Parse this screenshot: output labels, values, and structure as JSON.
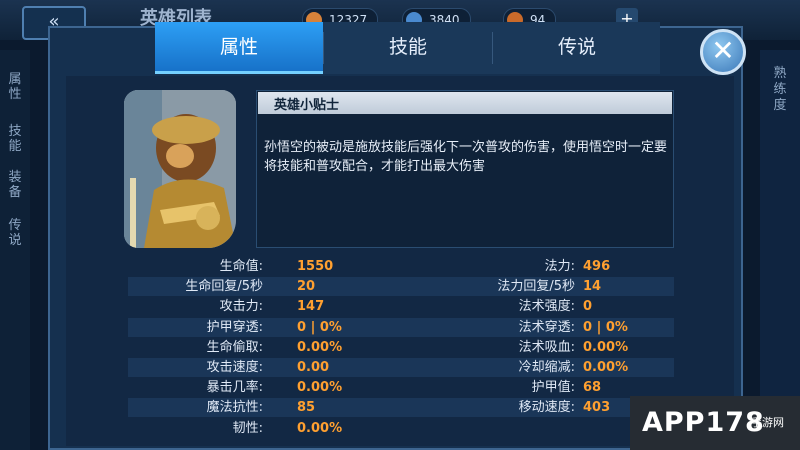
{
  "background": {
    "back_glyph": "«",
    "title": "英雄列表",
    "resources": [
      {
        "value": "12327",
        "color": "#d7823a"
      },
      {
        "value": "3840",
        "color": "#4a8ad0"
      },
      {
        "value": "94",
        "color": "#c96a2a"
      }
    ],
    "plus": "+",
    "left_tabs": [
      "属性",
      "技能",
      "装备",
      "传说"
    ],
    "right_tab": "熟练度"
  },
  "modal": {
    "tabs": [
      "属性",
      "技能",
      "传说"
    ],
    "active_tab": 0,
    "close_glyph": "✕",
    "tip": {
      "title": "英雄小贴士",
      "text": "孙悟空的被动是施放技能后强化下一次普攻的伤害，使用悟空时一定要将技能和普攻配合，才能打出最大伤害"
    },
    "stats": [
      {
        "l_label": "生命值:",
        "l_value": "1550",
        "r_label": "法力:",
        "r_value": "496"
      },
      {
        "l_label": "生命回复/5秒",
        "l_value": "20",
        "r_label": "法力回复/5秒",
        "r_value": "14"
      },
      {
        "l_label": "攻击力:",
        "l_value": "147",
        "r_label": "法术强度:",
        "r_value": "0"
      },
      {
        "l_label": "护甲穿透:",
        "l_value": "0 | 0%",
        "r_label": "法术穿透:",
        "r_value": "0 | 0%"
      },
      {
        "l_label": "生命偷取:",
        "l_value": "0.00%",
        "r_label": "法术吸血:",
        "r_value": "0.00%"
      },
      {
        "l_label": "攻击速度:",
        "l_value": "0.00",
        "r_label": "冷却缩减:",
        "r_value": "0.00%"
      },
      {
        "l_label": "暴击几率:",
        "l_value": "0.00%",
        "r_label": "护甲值:",
        "r_value": "68"
      },
      {
        "l_label": "魔法抗性:",
        "l_value": "85",
        "r_label": "移动速度:",
        "r_value": "403"
      },
      {
        "l_label": "韧性:",
        "l_value": "0.00%",
        "r_label": "",
        "r_value": ""
      }
    ]
  },
  "watermark": {
    "main": "APP178",
    "sub": "手游网"
  }
}
